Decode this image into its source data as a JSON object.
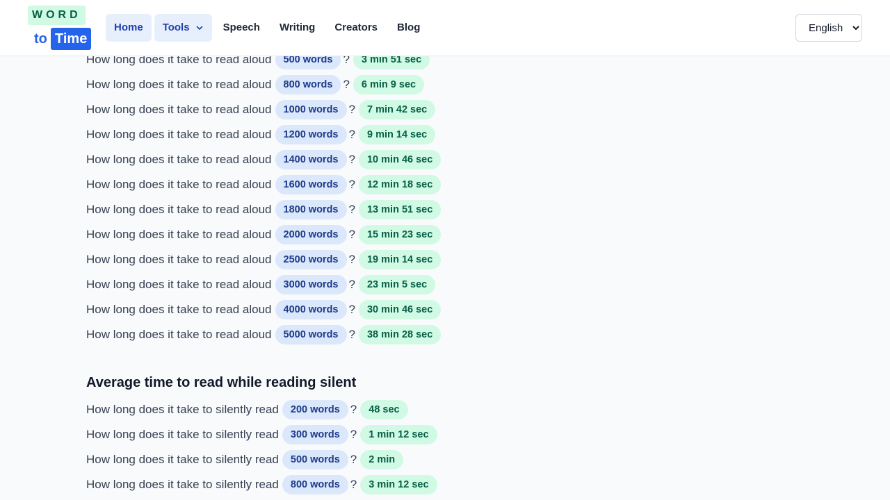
{
  "logo": {
    "word": "WORD",
    "to": "to",
    "time": "Time"
  },
  "nav": [
    {
      "label": "Home",
      "name": "nav-home",
      "active": true
    },
    {
      "label": "Tools",
      "name": "nav-tools",
      "dropdown": true
    },
    {
      "label": "Speech",
      "name": "nav-speech"
    },
    {
      "label": "Writing",
      "name": "nav-writing"
    },
    {
      "label": "Creators",
      "name": "nav-creators"
    },
    {
      "label": "Blog",
      "name": "nav-blog"
    }
  ],
  "language": {
    "selected": "English"
  },
  "aloud": {
    "prefix": "How long does it take to read aloud",
    "rows": [
      {
        "words": "500 words",
        "time": "3 min 51 sec"
      },
      {
        "words": "800 words",
        "time": "6 min 9 sec"
      },
      {
        "words": "1000 words",
        "time": "7 min 42 sec"
      },
      {
        "words": "1200 words",
        "time": "9 min 14 sec"
      },
      {
        "words": "1400 words",
        "time": "10 min 46 sec"
      },
      {
        "words": "1600 words",
        "time": "12 min 18 sec"
      },
      {
        "words": "1800 words",
        "time": "13 min 51 sec"
      },
      {
        "words": "2000 words",
        "time": "15 min 23 sec"
      },
      {
        "words": "2500 words",
        "time": "19 min 14 sec"
      },
      {
        "words": "3000 words",
        "time": "23 min 5 sec"
      },
      {
        "words": "4000 words",
        "time": "30 min 46 sec"
      },
      {
        "words": "5000 words",
        "time": "38 min 28 sec"
      }
    ]
  },
  "silent": {
    "title": "Average time to read while reading silent",
    "prefix": "How long does it take to silently read",
    "rows": [
      {
        "words": "200 words",
        "time": "48 sec"
      },
      {
        "words": "300 words",
        "time": "1 min 12 sec"
      },
      {
        "words": "500 words",
        "time": "2 min"
      },
      {
        "words": "800 words",
        "time": "3 min 12 sec"
      }
    ]
  },
  "qmark": "?"
}
